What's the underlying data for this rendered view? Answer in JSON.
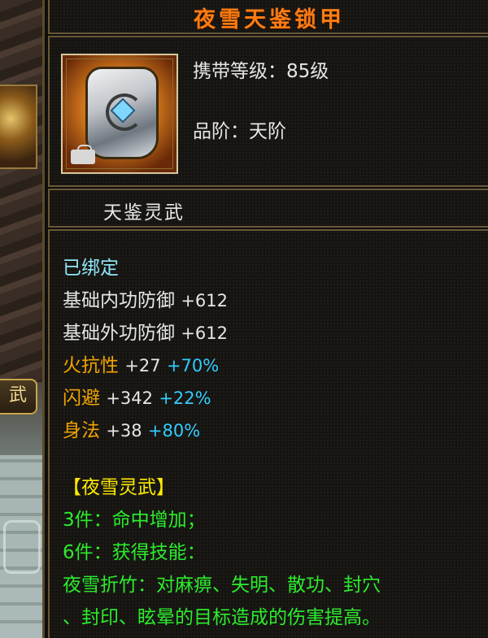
{
  "item": {
    "name": "夜雪天鉴锁甲",
    "carry_level": "携带等级：85级",
    "grade": "品阶：天阶",
    "series": "天鉴灵武"
  },
  "side_tab": {
    "label": "武"
  },
  "attributes": {
    "bound": "已绑定",
    "inner_def": {
      "label": "基础内功防御",
      "value": "+612"
    },
    "outer_def": {
      "label": "基础外功防御",
      "value": "+612"
    },
    "fire_res": {
      "label": "火抗性",
      "value": "+27",
      "bonus": "+70%"
    },
    "dodge": {
      "label": "闪避",
      "value": "+342",
      "bonus": "+22%"
    },
    "agility": {
      "label": "身法",
      "value": "+38",
      "bonus": "+80%"
    }
  },
  "set": {
    "name": "【夜雪灵武】",
    "bonus3": "3件：命中增加；",
    "bonus6": "6件：获得技能：",
    "skill_line1": "夜雪折竹：对麻痹、失明、散功、封穴",
    "skill_line2": "、封印、眩晕的目标造成的伤害提高。"
  },
  "colors": {
    "title": "#ff7c12",
    "bound": "#8fe6f6",
    "special_attr": "#f0a400",
    "set_name": "#ffea00",
    "set_bonus": "#2cec2c",
    "bonus_percent": "#33ccff"
  }
}
